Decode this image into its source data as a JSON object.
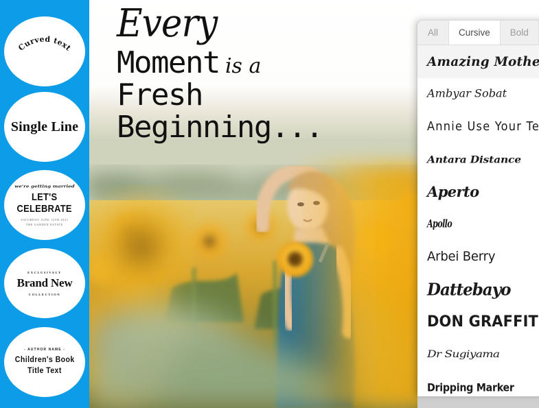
{
  "colors": {
    "sidebar_blue": "#0d9ce8",
    "panel_bg": "#ffffff",
    "tab_inactive_bg": "#efefef",
    "tab_active_bg": "#ffffff",
    "row_selected_bg": "#f4f4f4",
    "text_dark": "#1b1b1b"
  },
  "sidebar": {
    "presets": [
      {
        "id": "curved-text",
        "label": "Curved text"
      },
      {
        "id": "single-line",
        "label": "Single Line"
      },
      {
        "id": "lets-celebrate",
        "script_line": "we're getting married",
        "line1": "LET'S",
        "line2": "CELEBRATE",
        "small1": "SATURDAY JUNE 12TH 2021",
        "small2": "THE GARDEN ESTATE"
      },
      {
        "id": "brand-new",
        "overline": "EXCLUSIVELY",
        "label": "Brand New",
        "underline": "COLLECTION"
      },
      {
        "id": "childrens-book",
        "overline": "- AUTHOR NAME -",
        "line1": "Children's Book",
        "line2": "Title Text"
      }
    ]
  },
  "canvas": {
    "headline": {
      "line1": "Every",
      "line2": "Moment",
      "line2_suffix": "is a",
      "line3": "Fresh",
      "line4": "Beginning..."
    },
    "photo_alt": "Woman in blue dress holding a sunflower in a sunflower field"
  },
  "font_panel": {
    "tabs": [
      {
        "label": "All",
        "active": false
      },
      {
        "label": "Cursive",
        "active": true
      },
      {
        "label": "Bold",
        "active": false
      }
    ],
    "fonts": [
      {
        "name": "Amazing Mother",
        "selected": true
      },
      {
        "name": "Ambyar Sobat",
        "selected": false
      },
      {
        "name": "Annie Use Your Telescope",
        "selected": false
      },
      {
        "name": "Antara Distance",
        "selected": false
      },
      {
        "name": "Aperto",
        "selected": false
      },
      {
        "name": "Apollo",
        "selected": false
      },
      {
        "name": "Arbei Berry",
        "selected": false
      },
      {
        "name": "Dattebayo",
        "selected": false
      },
      {
        "name": "DON GRAFFITI",
        "selected": false
      },
      {
        "name": "Dr Sugiyama",
        "selected": false
      },
      {
        "name": "Dripping Marker",
        "selected": false
      }
    ]
  }
}
